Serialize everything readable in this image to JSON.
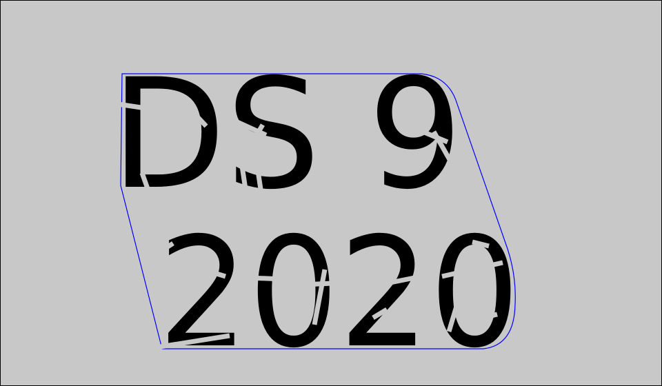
{
  "plate": {
    "line1": "DS 9",
    "line2": "2020"
  },
  "colors": {
    "background": "#c8c8c8",
    "border": "#000000",
    "outline": "#0000ff",
    "text": "#000000"
  }
}
